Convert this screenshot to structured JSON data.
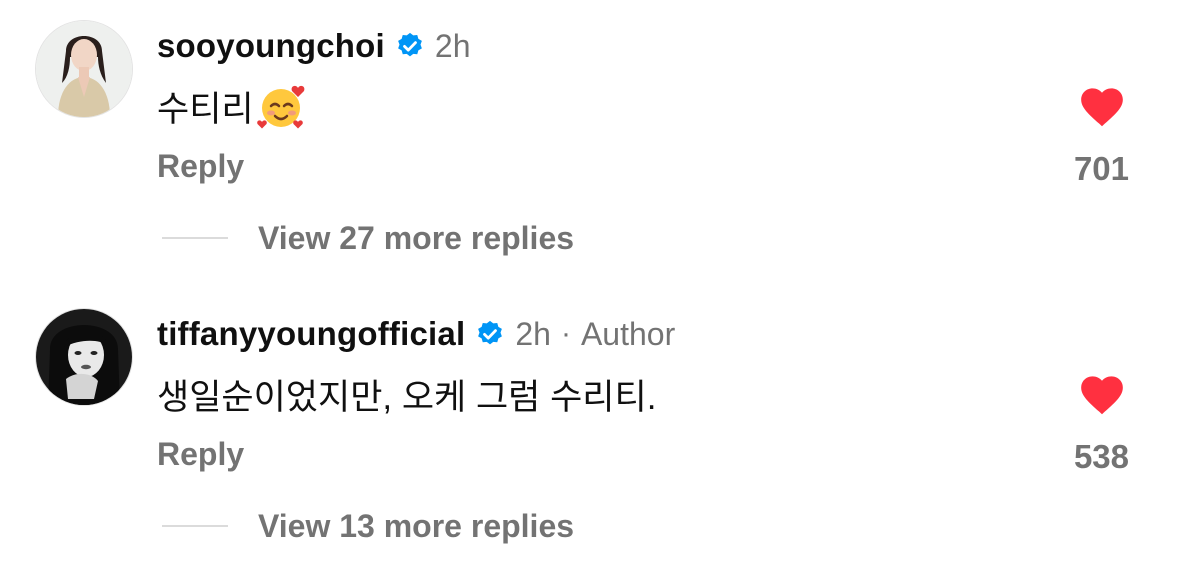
{
  "comments": [
    {
      "username": "sooyoungchoi",
      "verified": true,
      "time": "2h",
      "author_label": "",
      "text": "수티리",
      "emoji": "smiling-face-with-hearts",
      "reply_label": "Reply",
      "like_count": "701",
      "view_replies_label": "View 27 more replies",
      "avatar_icon": "user-avatar-photo"
    },
    {
      "username": "tiffanyyoungofficial",
      "verified": true,
      "time": "2h",
      "separator": "·",
      "author_label": "Author",
      "text": "생일순이었지만, 오케 그럼 수리티.",
      "reply_label": "Reply",
      "like_count": "538",
      "view_replies_label": "View 13 more replies",
      "avatar_icon": "user-avatar-photo"
    }
  ],
  "colors": {
    "verified_blue": "#0095f6",
    "heart_red": "#ff3040",
    "muted_text": "#737373",
    "primary_text": "#101010",
    "divider": "#dbdbdb"
  }
}
